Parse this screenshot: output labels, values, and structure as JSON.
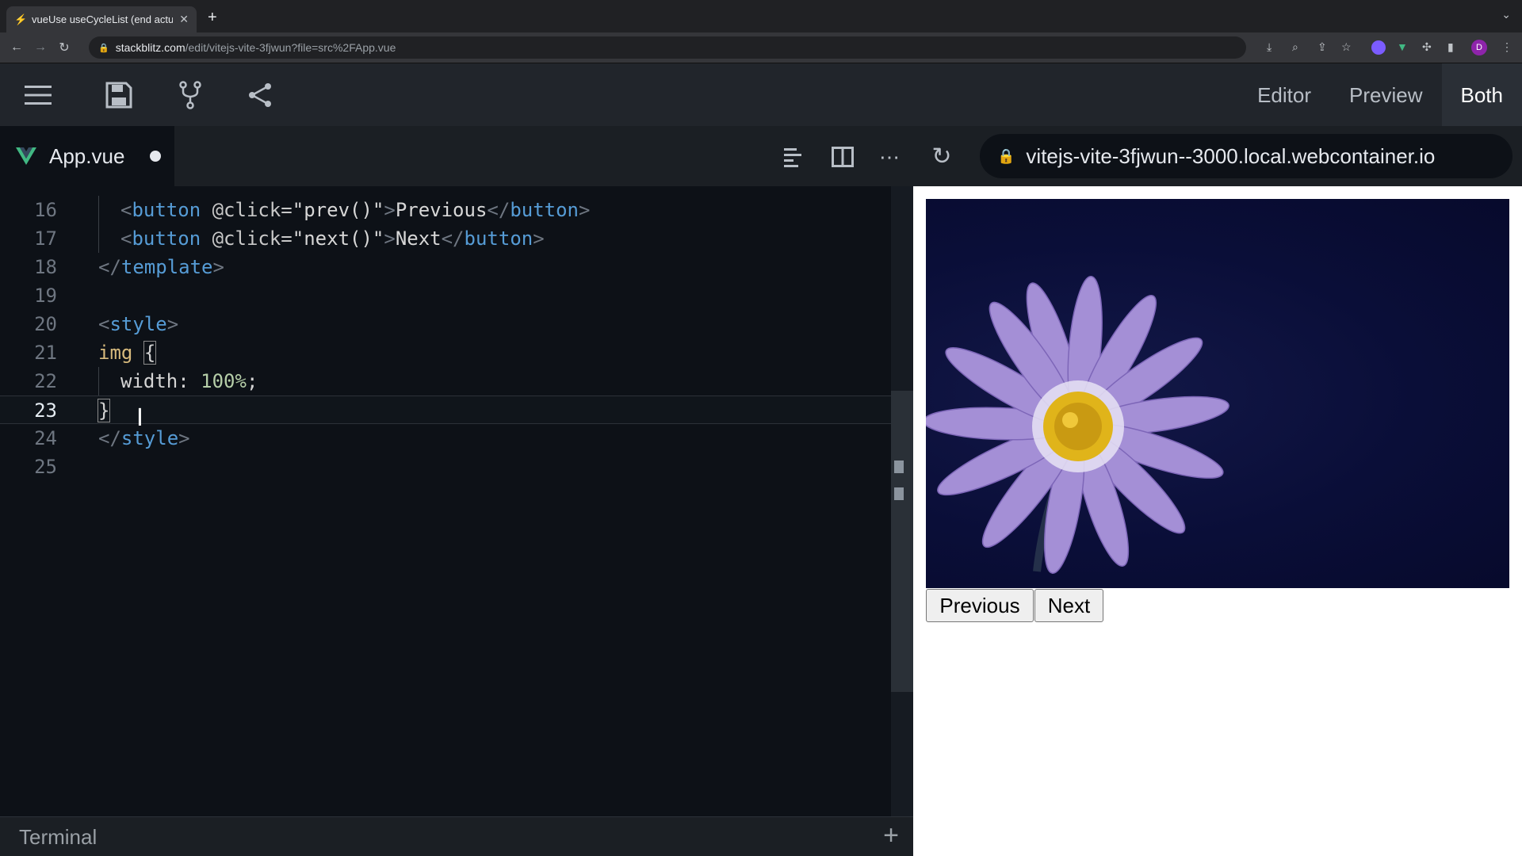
{
  "browser": {
    "tab_title": "vueUse useCycleList (end actu",
    "url_host": "stackblitz.com",
    "url_path": "/edit/vitejs-vite-3fjwun?file=src%2FApp.vue"
  },
  "toolbar": {
    "modes": [
      "Editor",
      "Preview",
      "Both"
    ],
    "active_mode": "Both"
  },
  "editor": {
    "file_name": "App.vue",
    "lines": [
      {
        "n": "16"
      },
      {
        "n": "17"
      },
      {
        "n": "18"
      },
      {
        "n": "19"
      },
      {
        "n": "20"
      },
      {
        "n": "21"
      },
      {
        "n": "22"
      },
      {
        "n": "23"
      },
      {
        "n": "24"
      },
      {
        "n": "25"
      }
    ],
    "code": {
      "l16_tag_open": "button",
      "l16_attr": "@click=",
      "l16_str": "\"prev()\"",
      "l16_text": "Previous",
      "l16_tag_close": "button",
      "l17_tag_open": "button",
      "l17_attr": "@click=",
      "l17_str": "\"next()\"",
      "l17_text": "Next",
      "l17_tag_close": "button",
      "l18_tag": "template",
      "l20_tag": "style",
      "l21_selector": "img",
      "l21_brace": "{",
      "l22_prop": "width",
      "l22_value": "100%",
      "l23_brace": "}",
      "l24_tag": "style"
    }
  },
  "preview": {
    "url": "vitejs-vite-3fjwun--3000.local.webcontainer.io",
    "prev_label": "Previous",
    "next_label": "Next"
  },
  "terminal": {
    "label": "Terminal"
  },
  "colors": {
    "accent": "#1389fd",
    "vue_green": "#41b883"
  }
}
